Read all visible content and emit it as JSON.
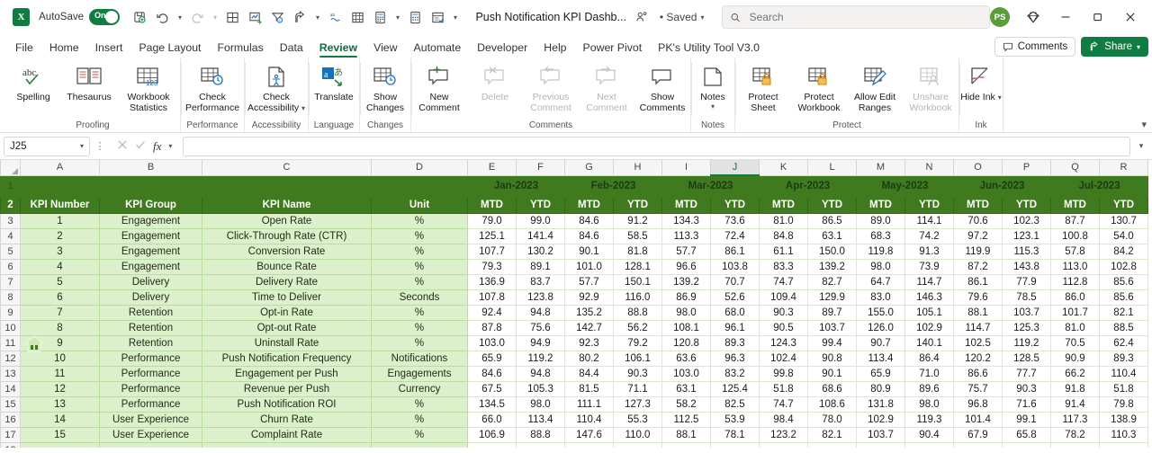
{
  "titlebar": {
    "app_logo": "excel-logo",
    "autosave_label": "AutoSave",
    "autosave_state": "On",
    "document_title": "Push Notification KPI Dashb...",
    "saved_state": "• Saved",
    "search_placeholder": "Search",
    "avatar_initials": "PS",
    "quick_access": [
      {
        "name": "save-icon",
        "label": "Save"
      },
      {
        "name": "undo-icon",
        "label": "Undo"
      },
      {
        "name": "redo-icon",
        "label": "Redo"
      },
      {
        "name": "borders-icon",
        "label": "Borders"
      },
      {
        "name": "chart-icon",
        "label": "Chart"
      },
      {
        "name": "filter-icon",
        "label": "Filter"
      },
      {
        "name": "share-arrow-icon",
        "label": "Share"
      },
      {
        "name": "spelling-icon",
        "label": "Spelling"
      },
      {
        "name": "table-icon",
        "label": "Table"
      },
      {
        "name": "calculator-icon",
        "label": "Calculate"
      },
      {
        "name": "calculator2-icon",
        "label": "Calculate Sheet"
      },
      {
        "name": "form-icon",
        "label": "Form"
      },
      {
        "name": "customize-qat-icon",
        "label": "Customize Quick Access Toolbar"
      }
    ],
    "window_buttons": [
      "minimize",
      "restore",
      "close"
    ]
  },
  "tabs": [
    {
      "label": "File",
      "active": false
    },
    {
      "label": "Home",
      "active": false
    },
    {
      "label": "Insert",
      "active": false
    },
    {
      "label": "Page Layout",
      "active": false
    },
    {
      "label": "Formulas",
      "active": false
    },
    {
      "label": "Data",
      "active": false
    },
    {
      "label": "Review",
      "active": true
    },
    {
      "label": "View",
      "active": false
    },
    {
      "label": "Automate",
      "active": false
    },
    {
      "label": "Developer",
      "active": false
    },
    {
      "label": "Help",
      "active": false
    },
    {
      "label": "Power Pivot",
      "active": false
    },
    {
      "label": "PK's Utility Tool V3.0",
      "active": false
    }
  ],
  "tabbar_right": {
    "comments_label": "Comments",
    "share_label": "Share"
  },
  "ribbon": {
    "groups": [
      {
        "label": "Proofing",
        "buttons": [
          {
            "name": "spelling-button",
            "label": "Spelling",
            "icon": "abc-check-icon",
            "disabled": false,
            "dropdown": false
          },
          {
            "name": "thesaurus-button",
            "label": "Thesaurus",
            "icon": "book-icon",
            "disabled": false,
            "dropdown": false
          },
          {
            "name": "workbook-statistics-button",
            "label": "Workbook Statistics",
            "icon": "table-123-icon",
            "disabled": false,
            "dropdown": false
          }
        ]
      },
      {
        "label": "Performance",
        "buttons": [
          {
            "name": "check-performance-button",
            "label": "Check Performance",
            "icon": "table-clock-icon",
            "disabled": false,
            "dropdown": false
          }
        ]
      },
      {
        "label": "Accessibility",
        "buttons": [
          {
            "name": "check-accessibility-button",
            "label": "Check Accessibility",
            "icon": "page-person-icon",
            "disabled": false,
            "dropdown": true
          }
        ]
      },
      {
        "label": "Language",
        "buttons": [
          {
            "name": "translate-button",
            "label": "Translate",
            "icon": "translate-icon",
            "disabled": false,
            "dropdown": false
          }
        ]
      },
      {
        "label": "Changes",
        "buttons": [
          {
            "name": "show-changes-button",
            "label": "Show Changes",
            "icon": "table-history-icon",
            "disabled": false,
            "dropdown": false
          }
        ]
      },
      {
        "label": "Comments",
        "buttons": [
          {
            "name": "new-comment-button",
            "label": "New Comment",
            "icon": "comment-plus-icon",
            "disabled": false,
            "dropdown": false
          },
          {
            "name": "delete-comment-button",
            "label": "Delete",
            "icon": "comment-x-icon",
            "disabled": true,
            "dropdown": false
          },
          {
            "name": "previous-comment-button",
            "label": "Previous Comment",
            "icon": "comment-prev-icon",
            "disabled": true,
            "dropdown": false
          },
          {
            "name": "next-comment-button",
            "label": "Next Comment",
            "icon": "comment-next-icon",
            "disabled": true,
            "dropdown": false
          },
          {
            "name": "show-comments-button",
            "label": "Show Comments",
            "icon": "comment-icon",
            "disabled": false,
            "dropdown": false
          }
        ]
      },
      {
        "label": "Notes",
        "buttons": [
          {
            "name": "notes-button",
            "label": "Notes",
            "icon": "note-icon",
            "disabled": false,
            "dropdown": true
          }
        ]
      },
      {
        "label": "Protect",
        "buttons": [
          {
            "name": "protect-sheet-button",
            "label": "Protect Sheet",
            "icon": "sheet-lock-icon",
            "disabled": false,
            "dropdown": false
          },
          {
            "name": "protect-workbook-button",
            "label": "Protect Workbook",
            "icon": "workbook-lock-icon",
            "disabled": false,
            "dropdown": false
          },
          {
            "name": "allow-edit-ranges-button",
            "label": "Allow Edit Ranges",
            "icon": "table-pencil-icon",
            "disabled": false,
            "dropdown": false
          },
          {
            "name": "unshare-workbook-button",
            "label": "Unshare Workbook",
            "icon": "table-person-icon",
            "disabled": true,
            "dropdown": false
          }
        ]
      },
      {
        "label": "Ink",
        "buttons": [
          {
            "name": "hide-ink-button",
            "label": "Hide Ink",
            "icon": "hide-ink-icon",
            "disabled": false,
            "dropdown": true
          }
        ]
      }
    ]
  },
  "formula_bar": {
    "name_box": "J25",
    "formula_value": "",
    "cancel_icon": "cancel-icon",
    "enter_icon": "enter-icon",
    "fx_label": "fx"
  },
  "grid": {
    "columns": [
      "A",
      "B",
      "C",
      "D",
      "E",
      "F",
      "G",
      "H",
      "I",
      "J",
      "K",
      "L",
      "M",
      "N",
      "O",
      "P",
      "Q",
      "R"
    ],
    "selected_column": "J",
    "row_numbers": [
      "1",
      "2",
      "3",
      "4",
      "5",
      "6",
      "7",
      "8",
      "9",
      "10",
      "11",
      "12",
      "13",
      "14",
      "15",
      "16",
      "17",
      "18"
    ],
    "home_icon": "home-icon",
    "month_bands": [
      "Jan-2023",
      "Feb-2023",
      "Mar-2023",
      "Apr-2023",
      "May-2023",
      "Jun-2023",
      "Jul-2023"
    ],
    "headers_left": [
      "KPI Number",
      "KPI Group",
      "KPI Name",
      "Unit"
    ],
    "sub_headers": [
      "MTD",
      "YTD"
    ],
    "rows": [
      {
        "num": "1",
        "group": "Engagement",
        "name": "Open Rate",
        "unit": "%",
        "values": [
          "79.0",
          "99.0",
          "84.6",
          "91.2",
          "134.3",
          "73.6",
          "81.0",
          "86.5",
          "89.0",
          "114.1",
          "70.6",
          "102.3",
          "87.7",
          "130.7"
        ]
      },
      {
        "num": "2",
        "group": "Engagement",
        "name": "Click-Through Rate (CTR)",
        "unit": "%",
        "values": [
          "125.1",
          "141.4",
          "84.6",
          "58.5",
          "113.3",
          "72.4",
          "84.8",
          "63.1",
          "68.3",
          "74.2",
          "97.2",
          "123.1",
          "100.8",
          "54.0"
        ]
      },
      {
        "num": "3",
        "group": "Engagement",
        "name": "Conversion Rate",
        "unit": "%",
        "values": [
          "107.7",
          "130.2",
          "90.1",
          "81.8",
          "57.7",
          "86.1",
          "61.1",
          "150.0",
          "119.8",
          "91.3",
          "119.9",
          "115.3",
          "57.8",
          "84.2"
        ]
      },
      {
        "num": "4",
        "group": "Engagement",
        "name": "Bounce Rate",
        "unit": "%",
        "values": [
          "79.3",
          "89.1",
          "101.0",
          "128.1",
          "96.6",
          "103.8",
          "83.3",
          "139.2",
          "98.0",
          "73.9",
          "87.2",
          "143.8",
          "113.0",
          "102.8"
        ]
      },
      {
        "num": "5",
        "group": "Delivery",
        "name": "Delivery Rate",
        "unit": "%",
        "values": [
          "136.9",
          "83.7",
          "57.7",
          "150.1",
          "139.2",
          "70.7",
          "74.7",
          "82.7",
          "64.7",
          "114.7",
          "86.1",
          "77.9",
          "112.8",
          "85.6"
        ]
      },
      {
        "num": "6",
        "group": "Delivery",
        "name": "Time to Deliver",
        "unit": "Seconds",
        "values": [
          "107.8",
          "123.8",
          "92.9",
          "116.0",
          "86.9",
          "52.6",
          "109.4",
          "129.9",
          "83.0",
          "146.3",
          "79.6",
          "78.5",
          "86.0",
          "85.6"
        ]
      },
      {
        "num": "7",
        "group": "Retention",
        "name": "Opt-in Rate",
        "unit": "%",
        "values": [
          "92.4",
          "94.8",
          "135.2",
          "88.8",
          "98.0",
          "68.0",
          "90.3",
          "89.7",
          "155.0",
          "105.1",
          "88.1",
          "103.7",
          "101.7",
          "82.1"
        ]
      },
      {
        "num": "8",
        "group": "Retention",
        "name": "Opt-out Rate",
        "unit": "%",
        "values": [
          "87.8",
          "75.6",
          "142.7",
          "56.2",
          "108.1",
          "96.1",
          "90.5",
          "103.7",
          "126.0",
          "102.9",
          "114.7",
          "125.3",
          "81.0",
          "88.5"
        ]
      },
      {
        "num": "9",
        "group": "Retention",
        "name": "Uninstall Rate",
        "unit": "%",
        "values": [
          "103.0",
          "94.9",
          "92.3",
          "79.2",
          "120.8",
          "89.3",
          "124.3",
          "99.4",
          "90.7",
          "140.1",
          "102.5",
          "119.2",
          "70.5",
          "62.4"
        ]
      },
      {
        "num": "10",
        "group": "Performance",
        "name": "Push Notification Frequency",
        "unit": "Notifications",
        "values": [
          "65.9",
          "119.2",
          "80.2",
          "106.1",
          "63.6",
          "96.3",
          "102.4",
          "90.8",
          "113.4",
          "86.4",
          "120.2",
          "128.5",
          "90.9",
          "89.3"
        ]
      },
      {
        "num": "11",
        "group": "Performance",
        "name": "Engagement per Push",
        "unit": "Engagements",
        "values": [
          "84.6",
          "94.8",
          "84.4",
          "90.3",
          "103.0",
          "83.2",
          "99.8",
          "90.1",
          "65.9",
          "71.0",
          "86.6",
          "77.7",
          "66.2",
          "110.4"
        ]
      },
      {
        "num": "12",
        "group": "Performance",
        "name": "Revenue per Push",
        "unit": "Currency",
        "values": [
          "67.5",
          "105.3",
          "81.5",
          "71.1",
          "63.1",
          "125.4",
          "51.8",
          "68.6",
          "80.9",
          "89.6",
          "75.7",
          "90.3",
          "91.8",
          "51.8"
        ]
      },
      {
        "num": "13",
        "group": "Performance",
        "name": "Push Notification ROI",
        "unit": "%",
        "values": [
          "134.5",
          "98.0",
          "111.1",
          "127.3",
          "58.2",
          "82.5",
          "74.7",
          "108.6",
          "131.8",
          "98.0",
          "96.8",
          "71.6",
          "91.4",
          "79.8"
        ]
      },
      {
        "num": "14",
        "group": "User Experience",
        "name": "Churn Rate",
        "unit": "%",
        "values": [
          "66.0",
          "113.4",
          "110.4",
          "55.3",
          "112.5",
          "53.9",
          "98.4",
          "78.0",
          "102.9",
          "119.3",
          "101.4",
          "99.1",
          "117.3",
          "138.9"
        ]
      },
      {
        "num": "15",
        "group": "User Experience",
        "name": "Complaint Rate",
        "unit": "%",
        "values": [
          "106.9",
          "88.8",
          "147.6",
          "110.0",
          "88.1",
          "78.1",
          "123.2",
          "82.1",
          "103.7",
          "90.4",
          "67.9",
          "65.8",
          "78.2",
          "110.3"
        ]
      }
    ]
  },
  "colors": {
    "brand_green": "#107c41",
    "header_green": "#3f7a1e",
    "band_green": "#bfe3a0",
    "row_green": "#ddf0cc"
  }
}
